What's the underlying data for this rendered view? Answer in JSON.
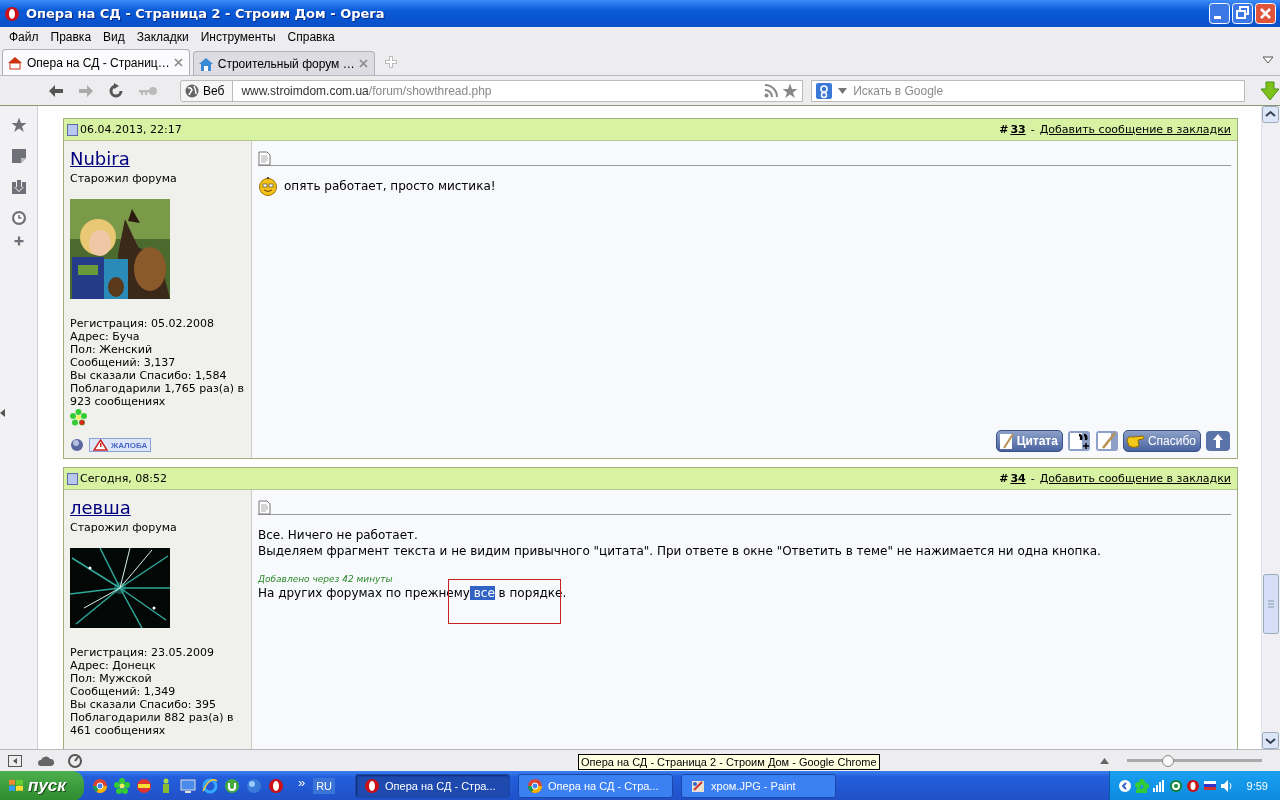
{
  "window": {
    "title": "Опера на СД - Страница 2 - Строим Дом - Opera"
  },
  "menu": [
    "Файл",
    "Правка",
    "Вид",
    "Закладки",
    "Инструменты",
    "Справка"
  ],
  "tabs": [
    {
      "label": "Опера на СД - Страниц…",
      "selected": true
    },
    {
      "label": "Строительный форум …",
      "selected": false
    }
  ],
  "address_bar": {
    "scope": "Веб",
    "url_host": "www.stroimdom.com.ua",
    "url_path": "/forum/showthread.php"
  },
  "search": {
    "placeholder": "Искать в Google"
  },
  "posts": [
    {
      "date": "06.04.2013, 22:17",
      "number_prefix": "#",
      "number": "33",
      "separator": "-",
      "bookmark_link": "Добавить сообщение в закладки",
      "author": "Nubira",
      "rank": "Старожил форума",
      "avatar": {
        "kind": "picture"
      },
      "stats": [
        "Регистрация: 05.02.2008",
        "Адрес: Буча",
        "Пол: Женский",
        "Сообщений: 3,137",
        "Вы сказали Спасибо: 1,584",
        "Поблагодарили 1,765 раз(а) в 923 сообщениях"
      ],
      "icq": true,
      "report": "ЖАЛОБА",
      "body": [
        {
          "kind": "smiley_line",
          "text": "опять работает, просто мистика!"
        }
      ],
      "actions": [
        {
          "kind": "quote",
          "label": "Цитата"
        },
        {
          "kind": "multiquote"
        },
        {
          "kind": "edit"
        },
        {
          "kind": "thanks",
          "label": "Спасибо"
        },
        {
          "kind": "top"
        }
      ]
    },
    {
      "date": "Сегодня, 08:52",
      "number_prefix": "#",
      "number": "34",
      "separator": "-",
      "bookmark_link": "Добавить сообщение в закладки",
      "author": "левша",
      "rank": "Старожил форума",
      "avatar": {
        "kind": "picture"
      },
      "stats": [
        "Регистрация: 23.05.2009",
        "Адрес: Донецк",
        "Пол: Мужской",
        "Сообщений: 1,349",
        "Вы сказали Спасибо: 395",
        "Поблагодарили 882 раз(а) в 461 сообщениях"
      ],
      "icq": false,
      "body": [
        {
          "kind": "line",
          "text": "Все. Ничего не работает."
        },
        {
          "kind": "line",
          "text": "Выделяем фрагмент текста и не видим привычного \"цитата\". При ответе в окне \"Ответить в теме\" не нажимается ни одна кнопка."
        },
        {
          "kind": "note",
          "text": "Добавлено через 42 минуты"
        },
        {
          "kind": "segments",
          "segments": [
            {
              "text": "На других форумах по прежнему",
              "selected": false
            },
            {
              "text": " все",
              "selected": true
            },
            {
              "text": " в порядке.",
              "selected": false
            }
          ]
        }
      ]
    }
  ],
  "status_bar": {
    "tooltip": "Опера на СД - Страница 2 - Строим Дом - Google Chrome",
    "zoom": {
      "level": 0.3
    }
  },
  "taskbar": {
    "start": "пуск",
    "more": "»",
    "language": "RU",
    "tasks": [
      {
        "label": "Опера на СД - Стра...",
        "selected": true,
        "kind": "opera"
      },
      {
        "label": "Опера на СД - Стра...",
        "selected": false,
        "kind": "chrome"
      },
      {
        "label": "хром.JPG - Paint",
        "selected": false,
        "kind": "paint"
      }
    ],
    "clock": "9:59"
  }
}
